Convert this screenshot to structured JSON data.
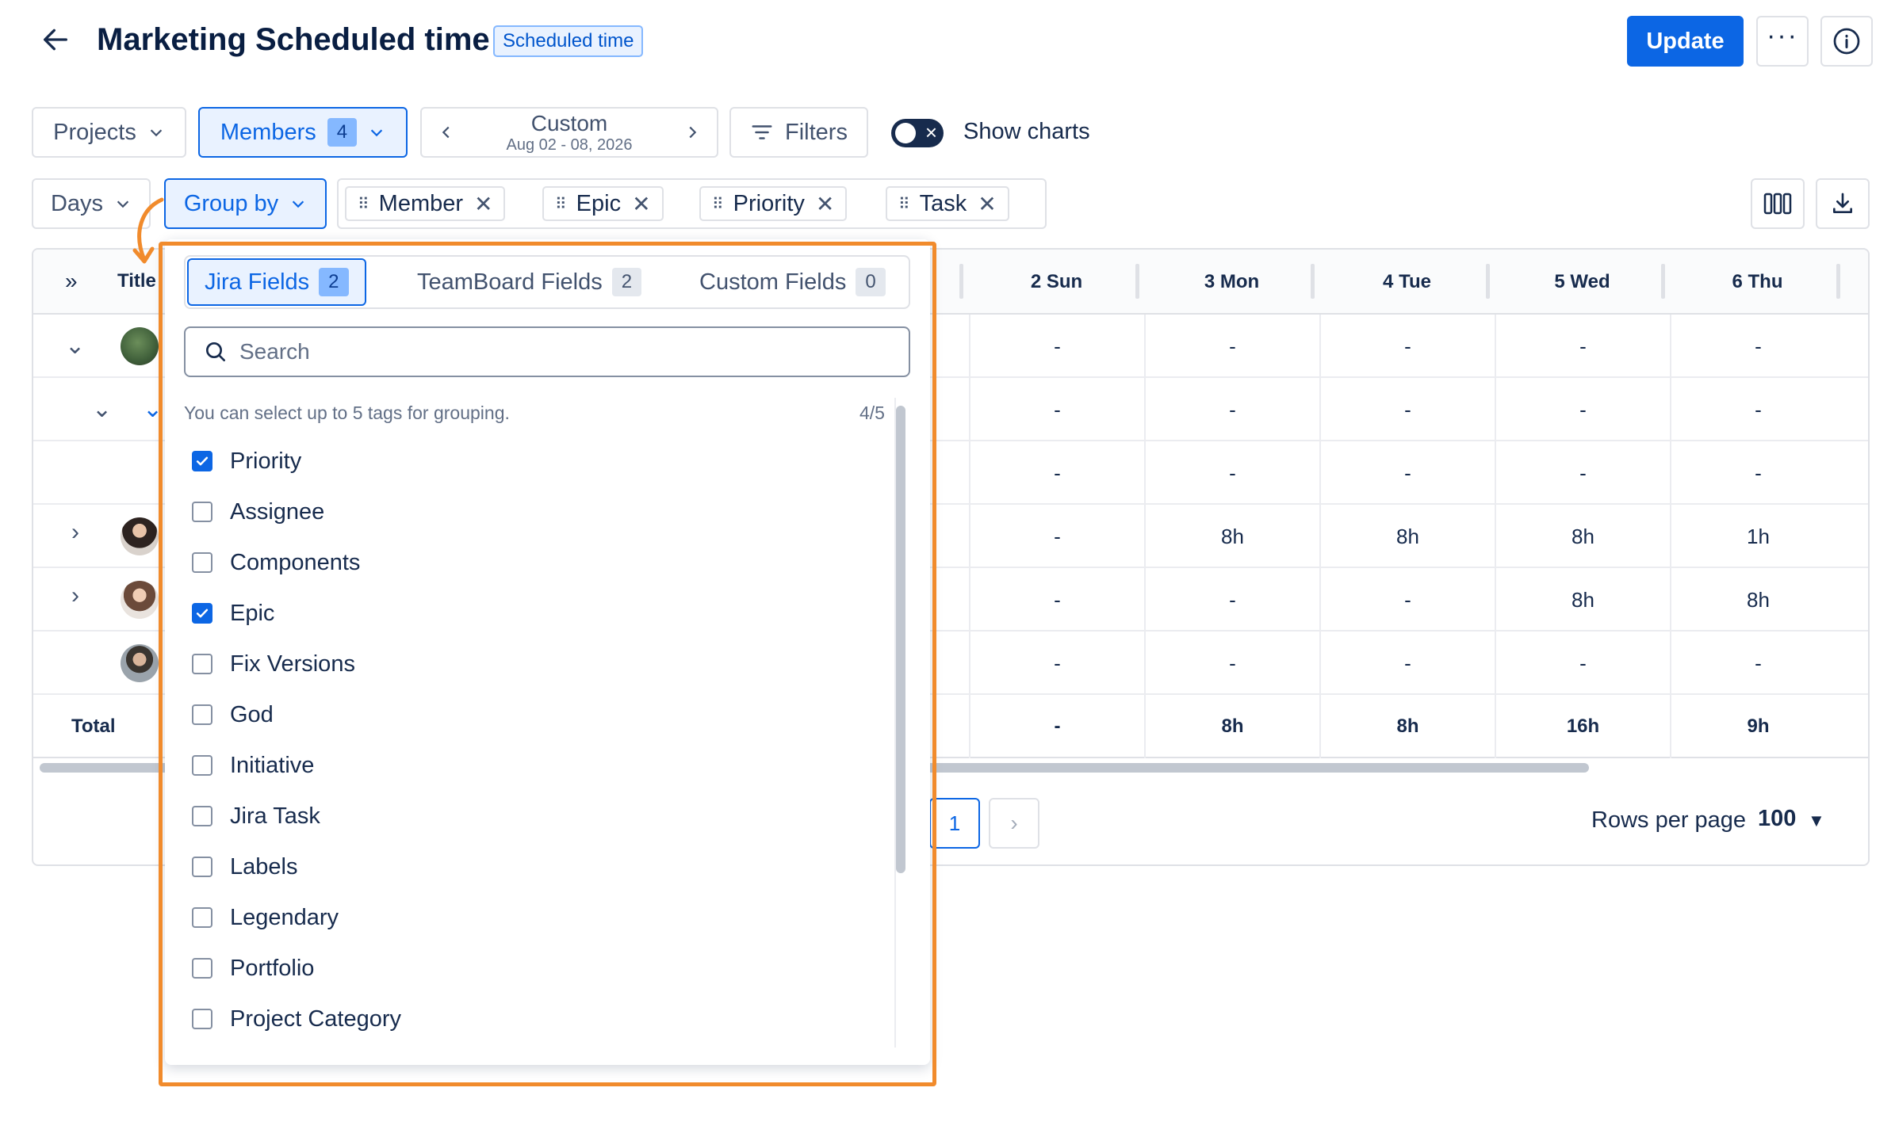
{
  "header": {
    "title": "Marketing Scheduled time",
    "badge": "Scheduled time",
    "update_label": "Update"
  },
  "filters": {
    "projects_label": "Projects",
    "members_label": "Members",
    "members_count": "4",
    "date_label": "Custom",
    "date_range": "Aug 02 - 08, 2026",
    "filters_label": "Filters",
    "show_charts_label": "Show charts",
    "show_charts_on": false
  },
  "grouping": {
    "days_label": "Days",
    "group_by_label": "Group by",
    "chips": [
      "Member",
      "Epic",
      "Priority",
      "Task"
    ]
  },
  "table": {
    "title_header": "Title",
    "days": [
      "2 Sun",
      "3 Mon",
      "4 Tue",
      "5 Wed",
      "6 Thu"
    ],
    "rows": [
      [
        "-",
        "-",
        "-",
        "-",
        "-"
      ],
      [
        "-",
        "-",
        "-",
        "-",
        "-"
      ],
      [
        "-",
        "-",
        "-",
        "-",
        "-"
      ],
      [
        "-",
        "8h",
        "8h",
        "8h",
        "1h"
      ],
      [
        "-",
        "-",
        "-",
        "8h",
        "8h"
      ],
      [
        "-",
        "-",
        "-",
        "-",
        "-"
      ]
    ],
    "total_label": "Total",
    "totals": [
      "-",
      "8h",
      "8h",
      "16h",
      "9h"
    ]
  },
  "pagination": {
    "current_page": "1",
    "rows_per_page_label": "Rows per page",
    "rows_per_page_value": "100"
  },
  "dropdown": {
    "tabs": [
      {
        "label": "Jira Fields",
        "count": "2"
      },
      {
        "label": "TeamBoard Fields",
        "count": "2"
      },
      {
        "label": "Custom Fields",
        "count": "0"
      }
    ],
    "search_placeholder": "Search",
    "hint": "You can select up to 5 tags for grouping.",
    "counter": "4/5",
    "options": [
      {
        "label": "Priority",
        "checked": true
      },
      {
        "label": "Assignee",
        "checked": false
      },
      {
        "label": "Components",
        "checked": false
      },
      {
        "label": "Epic",
        "checked": true
      },
      {
        "label": "Fix Versions",
        "checked": false
      },
      {
        "label": "God",
        "checked": false
      },
      {
        "label": "Initiative",
        "checked": false
      },
      {
        "label": "Jira Task",
        "checked": false
      },
      {
        "label": "Labels",
        "checked": false
      },
      {
        "label": "Legendary",
        "checked": false
      },
      {
        "label": "Portfolio",
        "checked": false
      },
      {
        "label": "Project Category",
        "checked": false
      }
    ]
  },
  "colors": {
    "accent": "#0c66e4",
    "highlight": "#f18b2c"
  }
}
